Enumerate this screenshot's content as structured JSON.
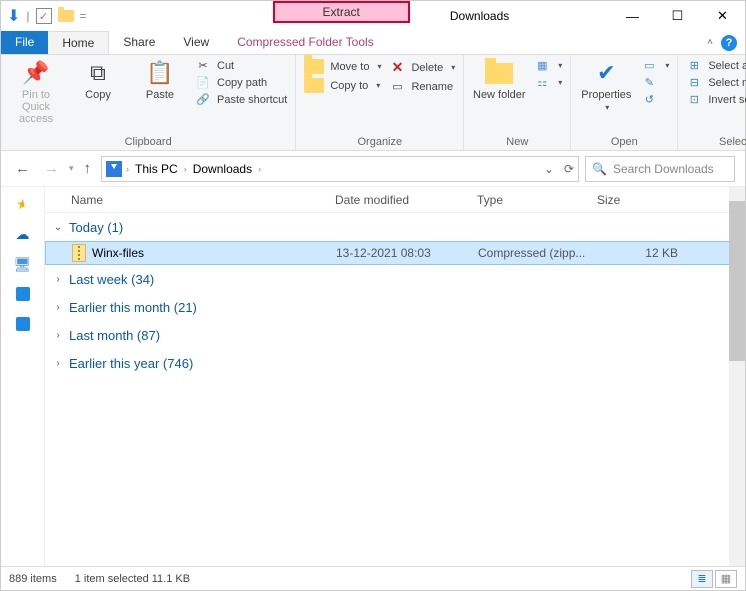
{
  "title": "Downloads",
  "contextual_tab": {
    "header": "Extract",
    "sub": "Compressed Folder Tools"
  },
  "tabs": {
    "file": "File",
    "home": "Home",
    "share": "Share",
    "view": "View"
  },
  "ribbon": {
    "clipboard": {
      "label": "Clipboard",
      "pin": "Pin to Quick access",
      "copy": "Copy",
      "paste": "Paste",
      "cut": "Cut",
      "copy_path": "Copy path",
      "paste_shortcut": "Paste shortcut"
    },
    "organize": {
      "label": "Organize",
      "move_to": "Move to",
      "copy_to": "Copy to",
      "delete": "Delete",
      "rename": "Rename"
    },
    "new": {
      "label": "New",
      "new_folder": "New folder"
    },
    "open": {
      "label": "Open",
      "properties": "Properties"
    },
    "select": {
      "label": "Select",
      "select_all": "Select all",
      "select_none": "Select none",
      "invert": "Invert selection"
    }
  },
  "breadcrumb": {
    "root": "This PC",
    "folder": "Downloads"
  },
  "search_placeholder": "Search Downloads",
  "columns": {
    "name": "Name",
    "date": "Date modified",
    "type": "Type",
    "size": "Size"
  },
  "groups": [
    {
      "label": "Today (1)",
      "expanded": true
    },
    {
      "label": "Last week (34)",
      "expanded": false
    },
    {
      "label": "Earlier this month (21)",
      "expanded": false
    },
    {
      "label": "Last month (87)",
      "expanded": false
    },
    {
      "label": "Earlier this year (746)",
      "expanded": false
    }
  ],
  "file": {
    "name": "Winx-files",
    "date": "13-12-2021 08:03",
    "type": "Compressed (zipp...",
    "size": "12 KB"
  },
  "status": {
    "item_count": "889 items",
    "selection": "1 item selected  11.1 KB"
  }
}
